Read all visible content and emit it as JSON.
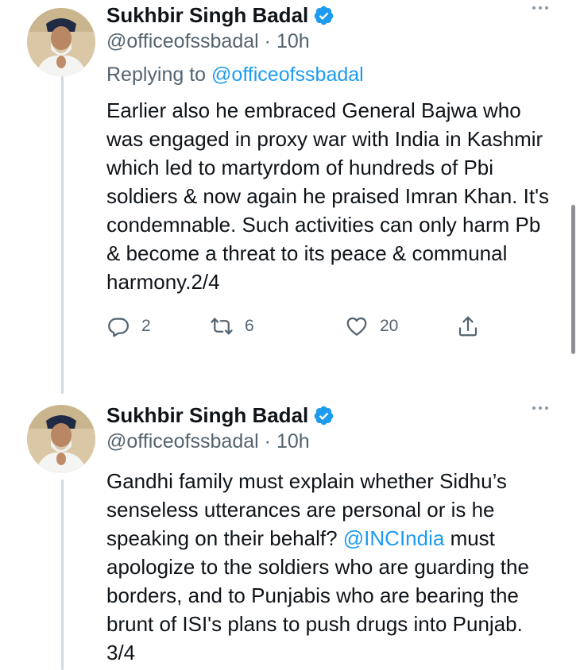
{
  "tweets": [
    {
      "author": {
        "name": "Sukhbir Singh Badal",
        "handle": "@officeofssbadal",
        "time_separator": "·",
        "time": "10h"
      },
      "replying_prefix": "Replying to ",
      "replying_to": "@officeofssbadal",
      "text": "Earlier also he embraced General Bajwa who was engaged in proxy war with India in Kashmir which led to martyrdom of hundreds of Pbi soldiers & now again he praised Imran Khan. It's condemnable. Such activities can only harm Pb & become a threat to its peace & communal harmony.2/4",
      "stats": {
        "replies": "2",
        "retweets": "6",
        "likes": "20"
      }
    },
    {
      "author": {
        "name": "Sukhbir Singh Badal",
        "handle": "@officeofssbadal",
        "time_separator": "·",
        "time": "10h"
      },
      "text_before": "Gandhi family must explain whether Sidhu’s senseless utterances are personal or is he speaking on their behalf? ",
      "mention": "@INCIndia",
      "text_after": " must apologize to the soldiers who are guarding the borders, and to Punjabis who are bearing the brunt of ISI's plans to push drugs into Punjab. 3/4"
    }
  ],
  "icons": {
    "verified": "verified-badge-icon",
    "more": "more-options-icon",
    "reply": "reply-icon",
    "retweet": "retweet-icon",
    "like": "heart-icon",
    "share": "share-icon"
  },
  "colors": {
    "link": "#1d9bf0",
    "secondary_text": "#536471",
    "primary_text": "#0f1419",
    "thread_line": "#cfd9de"
  }
}
